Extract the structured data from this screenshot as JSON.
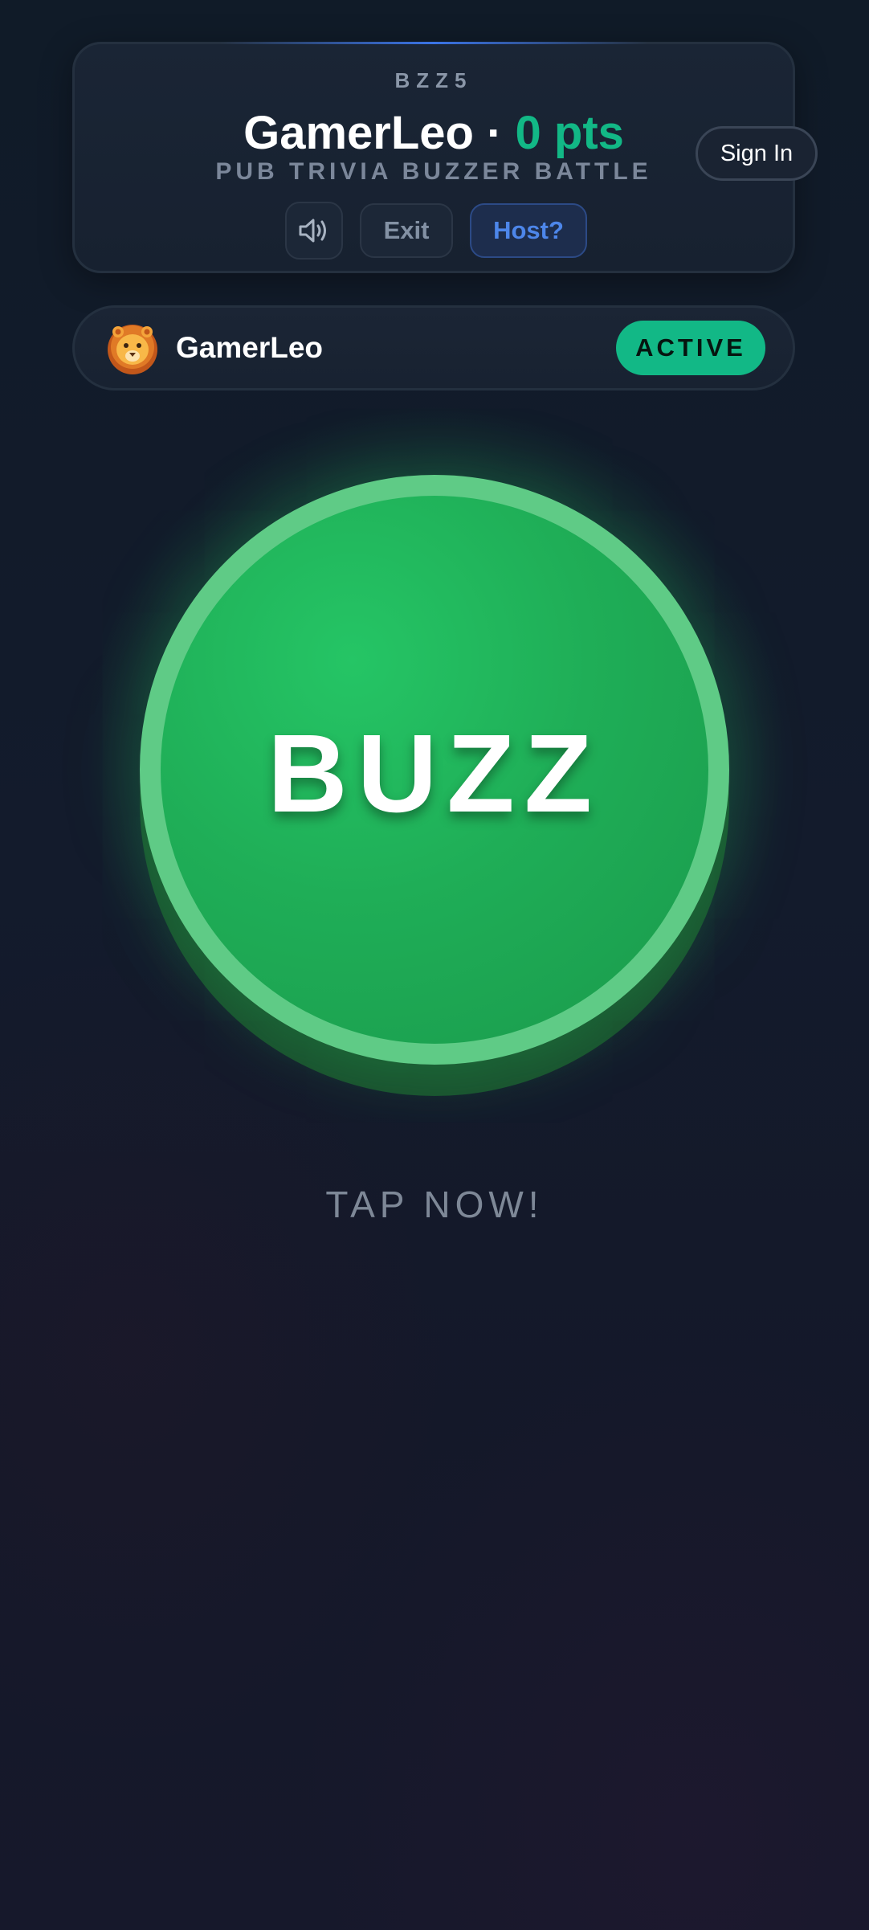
{
  "header": {
    "code": "BZZ5",
    "player_name": "GamerLeo",
    "separator": "·",
    "points": "0 pts",
    "subtitle": "PUB TRIVIA BUZZER BATTLE",
    "sound_icon": "speaker-volume-icon",
    "exit_label": "Exit",
    "host_label": "Host?"
  },
  "auth": {
    "sign_in_label": "Sign In"
  },
  "player": {
    "avatar": "🦁",
    "avatar_icon": "lion-icon",
    "name": "GamerLeo",
    "status": "ACTIVE"
  },
  "buzzer": {
    "label": "BUZZ",
    "prompt": "TAP NOW!"
  },
  "colors": {
    "accent_green": "#12b886",
    "buzz_green": "#22c55e",
    "host_blue": "#4d86ea",
    "background": "#131b2c"
  }
}
